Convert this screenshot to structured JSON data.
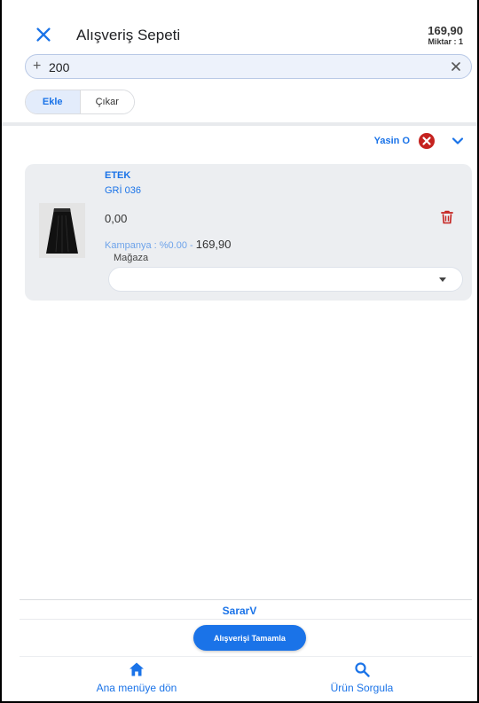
{
  "header": {
    "title": "Alışveriş Sepeti",
    "total_price": "169,90",
    "quantity_label": "Miktar : 1"
  },
  "search": {
    "prefix": "+",
    "value": "200"
  },
  "mode_toggle": {
    "add_label": "Ekle",
    "remove_label": "Çıkar",
    "active": "Ekle"
  },
  "customer": {
    "name": "Yasin O"
  },
  "cart_item": {
    "name": "ETEK",
    "variant": "GRİ 036",
    "price": "0,00",
    "campaign_label": "Kampanya : %0.00 -",
    "campaign_price": "169,90",
    "store_label": "Mağaza",
    "store_value": ""
  },
  "footer": {
    "store_code": "SararV",
    "complete_label": "Alışverişi Tamamla"
  },
  "bottom_nav": {
    "home_label": "Ana menüye dön",
    "search_label": "Ürün Sorgula"
  },
  "icons": {
    "close": "close-icon",
    "clear": "clear-icon",
    "remove_customer": "remove-circle-icon",
    "expand": "chevron-down-icon",
    "delete": "trash-icon",
    "dropdown": "caret-down-icon",
    "home": "home-icon",
    "search": "search-icon"
  },
  "colors": {
    "accent": "#1a73e8",
    "danger": "#c5221f",
    "card_bg": "#eceef1",
    "search_bg": "#edf2fb"
  }
}
